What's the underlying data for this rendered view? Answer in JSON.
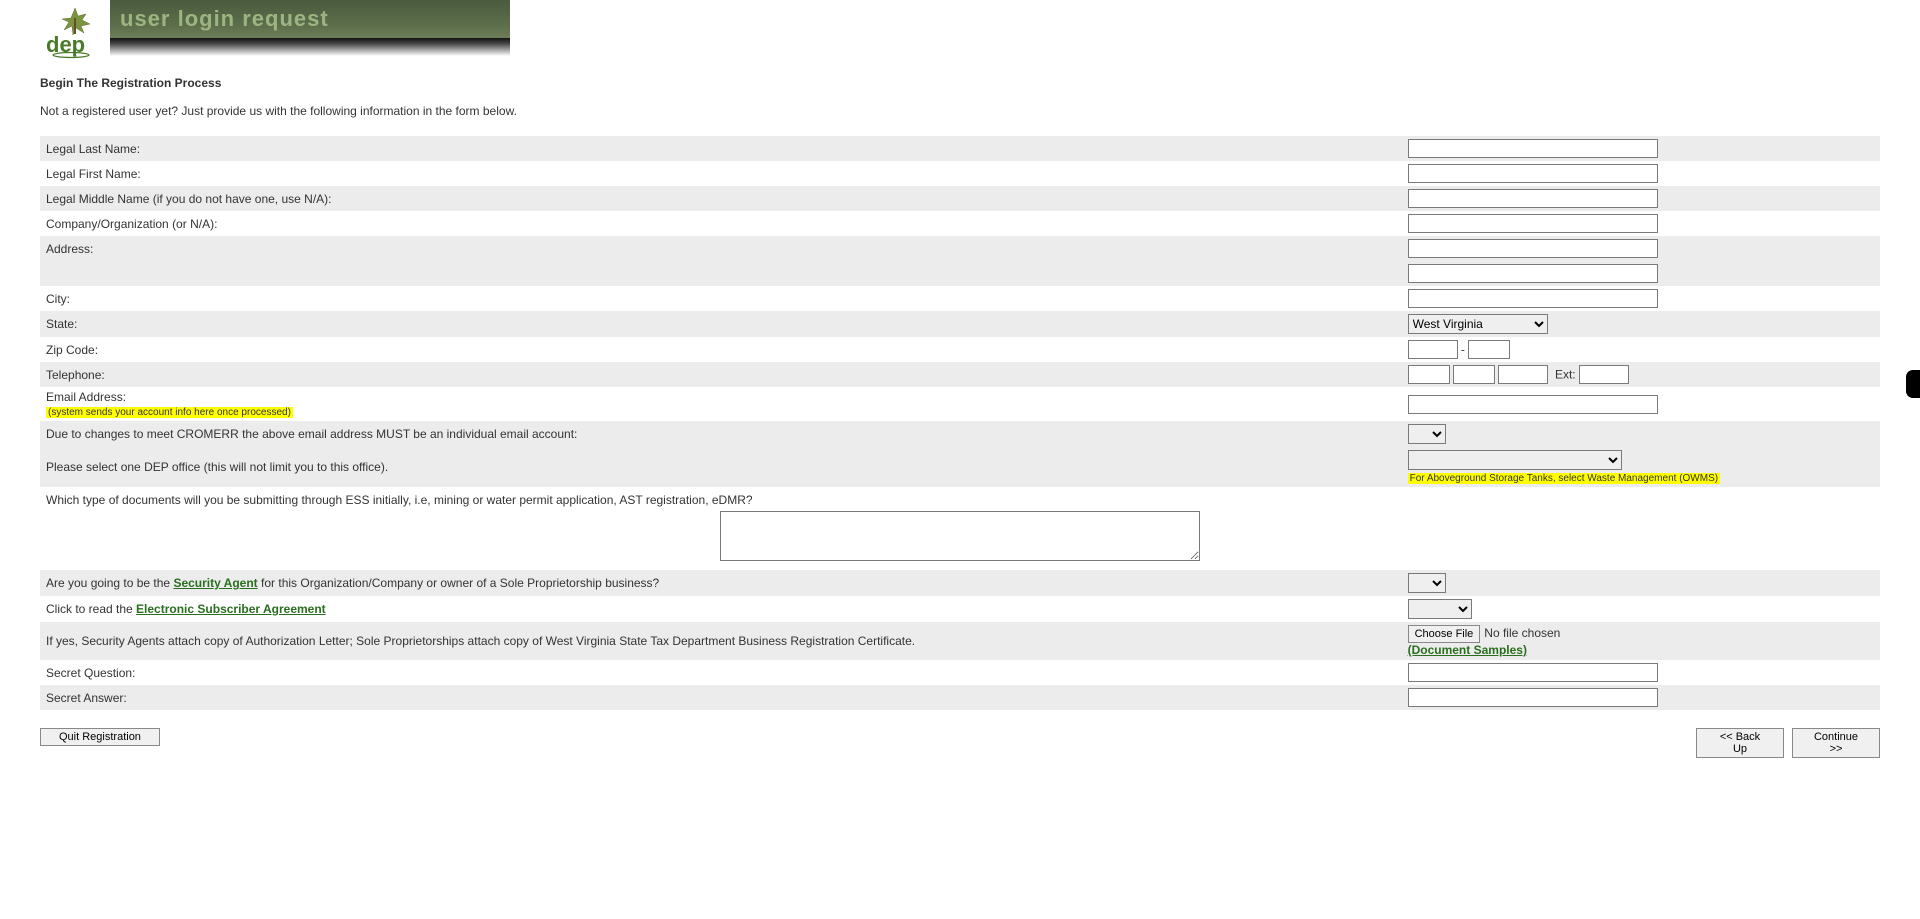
{
  "header": {
    "title": "user login request"
  },
  "section_title": "Begin The Registration Process",
  "intro_text": "Not a registered user yet? Just provide us with the following information in the form below.",
  "labels": {
    "last_name": "Legal Last Name:",
    "first_name": "Legal First Name:",
    "middle_name": "Legal Middle Name (if you do not have one, use N/A):",
    "company": "Company/Organization (or N/A):",
    "address": "Address:",
    "city": "City:",
    "state": "State:",
    "zip": "Zip Code:",
    "telephone": "Telephone:",
    "telephone_ext": "Ext:",
    "email": "Email Address:",
    "email_note": "(system sends your account info here once processed)",
    "cromerr": "Due to changes to meet CROMERR the above email address MUST be an individual email account:",
    "dep_office": "Please select one DEP office (this will not limit you to this office).",
    "dep_office_note": "For Aboveground Storage Tanks, select Waste Management (OWMS)",
    "doc_types": "Which type of documents will you be submitting through ESS initially, i.e, mining or water permit application, AST registration, eDMR?",
    "security_agent_pre": "Are you going to be the ",
    "security_agent_link": "Security Agent",
    "security_agent_post": " for this Organization/Company or owner of a Sole Proprietorship business?",
    "esa_pre": "Click to read the ",
    "esa_link": "Electronic Subscriber Agreement",
    "attach": "If yes, Security Agents attach copy of Authorization Letter; Sole Proprietorships attach copy of West Virginia State Tax Department Business Registration Certificate.",
    "doc_samples": "(Document Samples)",
    "secret_q": "Secret Question:",
    "secret_a": "Secret Answer:"
  },
  "state_selected": "West Virginia",
  "file": {
    "button": "Choose File",
    "status": "No file chosen"
  },
  "buttons": {
    "quit": "Quit Registration",
    "back": "<<  Back Up",
    "continue": "Continue >>"
  },
  "zip_sep": " - "
}
